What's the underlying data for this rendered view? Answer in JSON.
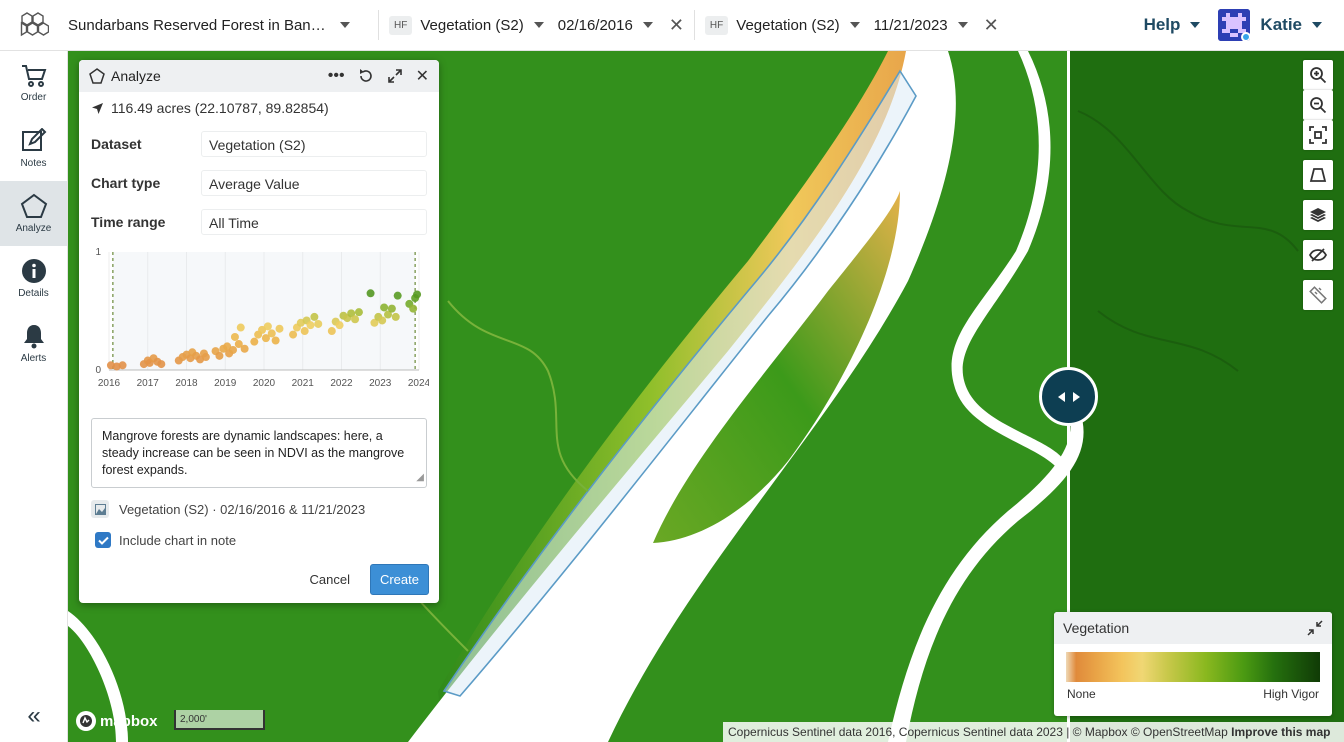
{
  "header": {
    "project_name": "Sundarbans Reserved Forest in Banglade...",
    "layer_left": {
      "badge": "HF",
      "name": "Vegetation (S2)",
      "date": "02/16/2016"
    },
    "layer_right": {
      "badge": "HF",
      "name": "Vegetation (S2)",
      "date": "11/21/2023"
    },
    "help_label": "Help",
    "user_name": "Katie"
  },
  "sidebar": {
    "items": [
      {
        "label": "Order",
        "icon": "cart-icon"
      },
      {
        "label": "Notes",
        "icon": "note-edit-icon"
      },
      {
        "label": "Analyze",
        "icon": "pentagon-icon",
        "active": true
      },
      {
        "label": "Details",
        "icon": "info-icon"
      },
      {
        "label": "Alerts",
        "icon": "bell-icon"
      }
    ],
    "collapse_label": "«"
  },
  "analyze": {
    "title": "Analyze",
    "area": "116.49 acres (22.10787, 89.82854)",
    "fields": [
      {
        "label": "Dataset",
        "value": "Vegetation (S2)"
      },
      {
        "label": "Chart type",
        "value": "Average Value"
      },
      {
        "label": "Time range",
        "value": "All Time"
      }
    ],
    "note_text": "Mangrove forests are dynamic landscapes: here, a steady increase can be seen in NDVI as the mangrove forest expands.",
    "source": "Vegetation (S2) · 02/16/2016 & 11/21/2023",
    "include_chart_label": "Include chart in note",
    "include_chart_checked": true,
    "cancel_label": "Cancel",
    "create_label": "Create"
  },
  "chart_data": {
    "type": "scatter",
    "title": "",
    "xlabel": "",
    "ylabel": "",
    "x_ticks": [
      "2016",
      "2017",
      "2018",
      "2019",
      "2020",
      "2021",
      "2022",
      "2023",
      "2024"
    ],
    "y_ticks": [
      "0",
      "1"
    ],
    "ylim": [
      0,
      1
    ],
    "xlim": [
      2016,
      2024
    ],
    "markers": [
      2016.1,
      2023.9
    ],
    "points": [
      [
        2016.05,
        0.04
      ],
      [
        2016.2,
        0.03
      ],
      [
        2016.35,
        0.04
      ],
      [
        2016.9,
        0.05
      ],
      [
        2017.0,
        0.08
      ],
      [
        2017.05,
        0.06
      ],
      [
        2017.15,
        0.1
      ],
      [
        2017.25,
        0.07
      ],
      [
        2017.35,
        0.05
      ],
      [
        2017.8,
        0.08
      ],
      [
        2017.9,
        0.11
      ],
      [
        2018.0,
        0.13
      ],
      [
        2018.1,
        0.1
      ],
      [
        2018.15,
        0.15
      ],
      [
        2018.25,
        0.12
      ],
      [
        2018.35,
        0.09
      ],
      [
        2018.45,
        0.14
      ],
      [
        2018.5,
        0.11
      ],
      [
        2018.75,
        0.16
      ],
      [
        2018.85,
        0.12
      ],
      [
        2018.95,
        0.18
      ],
      [
        2019.05,
        0.2
      ],
      [
        2019.1,
        0.14
      ],
      [
        2019.2,
        0.17
      ],
      [
        2019.25,
        0.28
      ],
      [
        2019.35,
        0.22
      ],
      [
        2019.4,
        0.36
      ],
      [
        2019.5,
        0.18
      ],
      [
        2019.75,
        0.24
      ],
      [
        2019.85,
        0.3
      ],
      [
        2019.95,
        0.34
      ],
      [
        2020.05,
        0.27
      ],
      [
        2020.1,
        0.37
      ],
      [
        2020.2,
        0.31
      ],
      [
        2020.3,
        0.25
      ],
      [
        2020.4,
        0.35
      ],
      [
        2020.75,
        0.3
      ],
      [
        2020.85,
        0.36
      ],
      [
        2020.95,
        0.4
      ],
      [
        2021.05,
        0.33
      ],
      [
        2021.1,
        0.42
      ],
      [
        2021.2,
        0.38
      ],
      [
        2021.3,
        0.45
      ],
      [
        2021.4,
        0.39
      ],
      [
        2021.75,
        0.33
      ],
      [
        2021.85,
        0.41
      ],
      [
        2021.95,
        0.38
      ],
      [
        2022.05,
        0.46
      ],
      [
        2022.15,
        0.44
      ],
      [
        2022.25,
        0.48
      ],
      [
        2022.35,
        0.43
      ],
      [
        2022.45,
        0.49
      ],
      [
        2022.75,
        0.65
      ],
      [
        2022.85,
        0.4
      ],
      [
        2022.95,
        0.45
      ],
      [
        2023.05,
        0.42
      ],
      [
        2023.1,
        0.53
      ],
      [
        2023.2,
        0.47
      ],
      [
        2023.3,
        0.52
      ],
      [
        2023.4,
        0.45
      ],
      [
        2023.45,
        0.63
      ],
      [
        2023.75,
        0.56
      ],
      [
        2023.85,
        0.52
      ],
      [
        2023.9,
        0.61
      ],
      [
        2023.95,
        0.64
      ]
    ]
  },
  "legend": {
    "title": "Vegetation",
    "min_label": "None",
    "max_label": "High Vigor"
  },
  "map": {
    "scale_label": "2,000'",
    "mapbox_label": "mapbox",
    "attribution_text": "Copernicus Sentinel data 2016, Copernicus Sentinel data 2023 | © Mapbox © OpenStreetMap",
    "attribution_link": "Improve this map"
  },
  "colors": {
    "accent": "#3c8fd6",
    "nav_active": "#dfe4e7",
    "brand_text": "#1f4a63",
    "swipe_knob": "#0d3e52"
  }
}
